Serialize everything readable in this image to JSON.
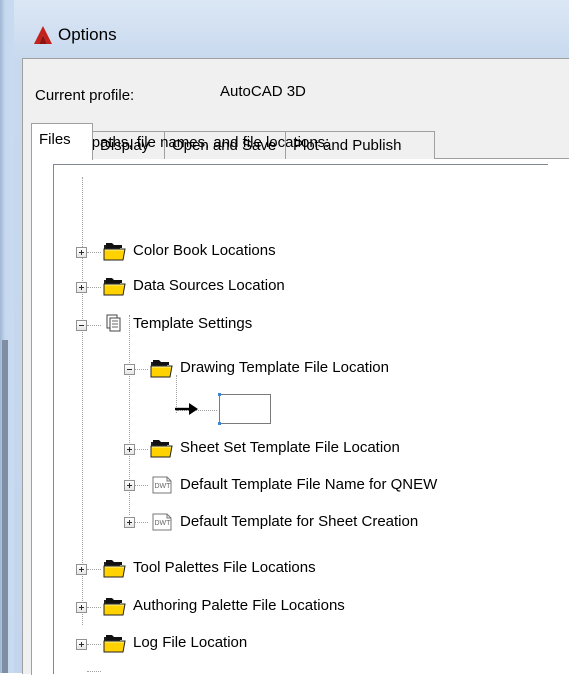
{
  "window": {
    "title": "Options",
    "app_icon": "autocad-logo-icon",
    "accent_color": "#c2221b"
  },
  "profile": {
    "label": "Current profile:",
    "value": "AutoCAD 3D"
  },
  "tabs": [
    {
      "label": "Files",
      "active": true
    },
    {
      "label": "Display",
      "active": false
    },
    {
      "label": "Open and Save",
      "active": false
    },
    {
      "label": "Plot and Publish",
      "active": false
    }
  ],
  "search_label": "Search paths, file names, and file locations:",
  "tree": {
    "items": [
      {
        "label": "Color Book Locations",
        "icon": "folder-stack-icon",
        "state": "collapsed"
      },
      {
        "label": "Data Sources Location",
        "icon": "folder-stack-icon",
        "state": "collapsed"
      },
      {
        "label": "Template Settings",
        "icon": "documents-icon",
        "state": "expanded"
      },
      {
        "label": "Drawing Template File Location",
        "icon": "folder-stack-icon",
        "state": "expanded"
      },
      {
        "label": "Sheet Set Template File Location",
        "icon": "folder-stack-icon",
        "state": "collapsed"
      },
      {
        "label": "Default Template File Name for QNEW",
        "icon": "dwt-file-icon",
        "state": "collapsed"
      },
      {
        "label": "Default Template for Sheet Creation",
        "icon": "dwt-file-icon",
        "state": "collapsed"
      },
      {
        "label": "Tool Palettes File Locations",
        "icon": "folder-stack-icon",
        "state": "collapsed"
      },
      {
        "label": "Authoring Palette File Locations",
        "icon": "folder-stack-icon",
        "state": "collapsed"
      },
      {
        "label": "Log File Location",
        "icon": "folder-stack-icon",
        "state": "collapsed"
      }
    ],
    "edit_value": "",
    "dwt_badge": "DWT"
  }
}
